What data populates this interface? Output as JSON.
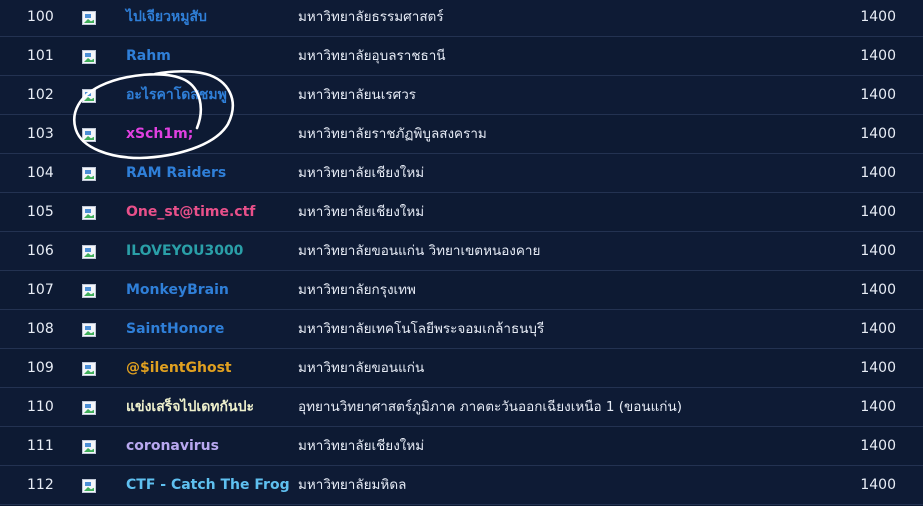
{
  "scoreboard": {
    "rows": [
      {
        "rank": "100",
        "team": "ไปเจียวหมูสับ",
        "team_color": "#2f7fd8",
        "university": "มหาวิทยาลัยธรรมศาสตร์",
        "score": "1400"
      },
      {
        "rank": "101",
        "team": "Rahm",
        "team_color": "#2f7fd8",
        "university": "มหาวิทยาลัยอุบลราชธานี",
        "score": "1400"
      },
      {
        "rank": "102",
        "team": "อะไรคาโดสชมพู",
        "team_color": "#2f7fd8",
        "university": "มหาวิทยาลัยนเรศวร",
        "score": "1400"
      },
      {
        "rank": "103",
        "team": "xSch1m;",
        "team_color": "#e040e0",
        "university": "มหาวิทยาลัยราชภัฏพิบูลสงคราม",
        "score": "1400"
      },
      {
        "rank": "104",
        "team": "RAM Raiders",
        "team_color": "#2f7fd8",
        "university": "มหาวิทยาลัยเชียงใหม่",
        "score": "1400"
      },
      {
        "rank": "105",
        "team": "One_st@time.ctf",
        "team_color": "#e8508a",
        "university": "มหาวิทยาลัยเชียงใหม่",
        "score": "1400"
      },
      {
        "rank": "106",
        "team": "ILOVEYOU3000",
        "team_color": "#2a9fa8",
        "university": "มหาวิทยาลัยขอนแก่น วิทยาเขตหนองคาย",
        "score": "1400"
      },
      {
        "rank": "107",
        "team": "MonkeyBrain",
        "team_color": "#2f7fd8",
        "university": "มหาวิทยาลัยกรุงเทพ",
        "score": "1400"
      },
      {
        "rank": "108",
        "team": "SaintHonore",
        "team_color": "#2f7fd8",
        "university": "มหาวิทยาลัยเทคโนโลยีพระจอมเกล้าธนบุรี",
        "score": "1400"
      },
      {
        "rank": "109",
        "team": "@$ilentGhost",
        "team_color": "#e0a020",
        "university": "มหาวิทยาลัยขอนแก่น",
        "score": "1400"
      },
      {
        "rank": "110",
        "team": "แข่งเสร็จไปเดทกันปะ",
        "team_color": "#eef0cc",
        "university": "อุทยานวิทยาศาสตร์ภูมิภาค ภาคตะวันออกเฉียงเหนือ 1 (ขอนแก่น)",
        "score": "1400"
      },
      {
        "rank": "111",
        "team": "coronavirus",
        "team_color": "#b8a8f0",
        "university": "มหาวิทยาลัยเชียงใหม่",
        "score": "1400"
      },
      {
        "rank": "112",
        "team": "CTF - Catch The Frog",
        "team_color": "#5fc0f0",
        "university": "มหาวิทยาลัยมหิดล",
        "score": "1400"
      }
    ]
  }
}
